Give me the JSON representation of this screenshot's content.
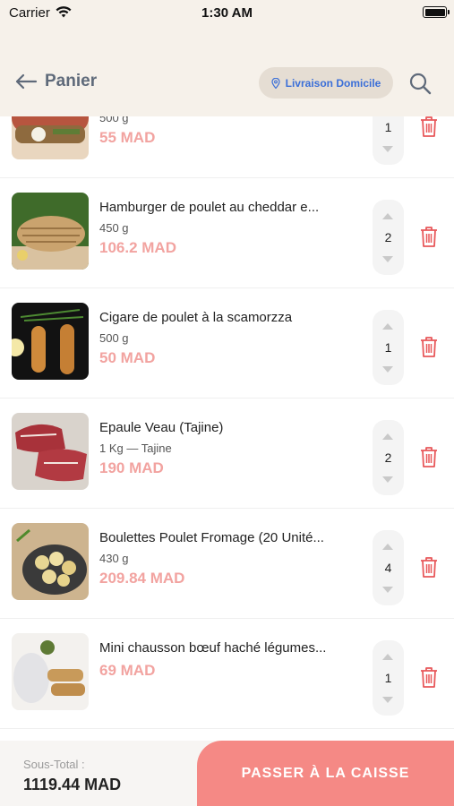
{
  "status_bar": {
    "carrier": "Carrier",
    "time": "1:30 AM"
  },
  "header": {
    "title": "Panier",
    "delivery_label": "Livraison Domicile",
    "colors": {
      "background": "#f6f1ea",
      "delivery_pill": "#e5ddd3",
      "delivery_text": "#3b6fd8"
    }
  },
  "cart": {
    "items": [
      {
        "name": "",
        "weight": "500 g",
        "price": "55 MAD",
        "quantity": "1"
      },
      {
        "name": "Hamburger de poulet au cheddar e...",
        "weight": "450 g",
        "price": "106.2 MAD",
        "quantity": "2"
      },
      {
        "name": "Cigare de poulet à la scamorzza",
        "weight": "500 g",
        "price": "50 MAD",
        "quantity": "1"
      },
      {
        "name": "Epaule Veau (Tajine)",
        "weight": "1 Kg — Tajine",
        "price": "190 MAD",
        "quantity": "2"
      },
      {
        "name": "Boulettes Poulet Fromage (20 Unité...",
        "weight": "430 g",
        "price": "209.84 MAD",
        "quantity": "4"
      },
      {
        "name": "Mini chausson bœuf haché légumes...",
        "weight": "",
        "price": "69 MAD",
        "quantity": "1"
      }
    ],
    "colors": {
      "price": "#f2a3a0",
      "trash": "#e8585a"
    }
  },
  "footer": {
    "subtotal_label": "Sous-Total :",
    "subtotal_value": "1119.44 MAD",
    "checkout_label": "PASSER À LA CAISSE",
    "colors": {
      "checkout": "#f58985"
    }
  },
  "icons": [
    "wifi-icon",
    "battery-icon",
    "back-arrow-icon",
    "location-pin-icon",
    "search-icon",
    "trash-icon",
    "chevron-up-icon",
    "chevron-down-icon"
  ]
}
